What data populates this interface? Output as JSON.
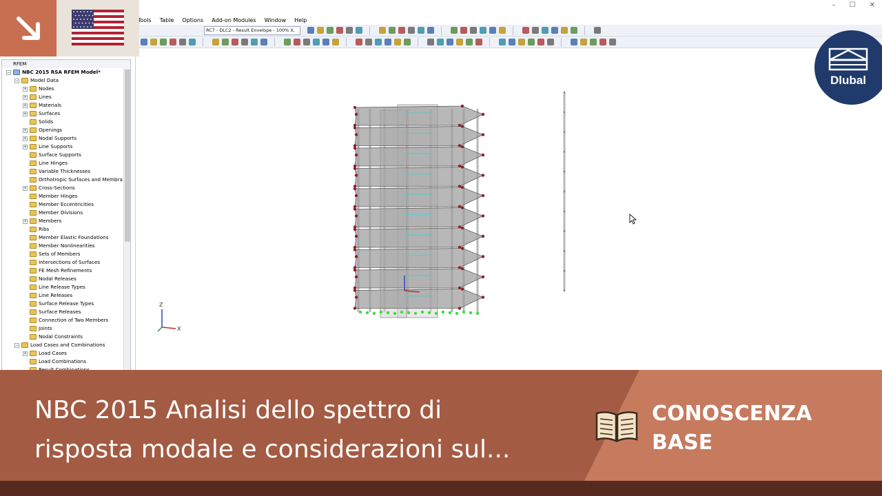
{
  "menu": [
    "Tools",
    "Table",
    "Options",
    "Add-on Modules",
    "Window",
    "Help"
  ],
  "toolbar": {
    "result_combo": "RC7 - DLC2 - Result Envelope - 100% X,"
  },
  "navigator": {
    "root": "RFEM",
    "model": "NBC 2015 RSA RFEM Model*",
    "items": [
      {
        "label": "Model Data",
        "level": 1,
        "expand": "-"
      },
      {
        "label": "Nodes",
        "level": 2,
        "expand": "+"
      },
      {
        "label": "Lines",
        "level": 2,
        "expand": "+"
      },
      {
        "label": "Materials",
        "level": 2,
        "expand": "+"
      },
      {
        "label": "Surfaces",
        "level": 2,
        "expand": "+"
      },
      {
        "label": "Solids",
        "level": 2,
        "expand": ""
      },
      {
        "label": "Openings",
        "level": 2,
        "expand": "+"
      },
      {
        "label": "Nodal Supports",
        "level": 2,
        "expand": "+"
      },
      {
        "label": "Line Supports",
        "level": 2,
        "expand": "+"
      },
      {
        "label": "Surface Supports",
        "level": 2,
        "expand": ""
      },
      {
        "label": "Line Hinges",
        "level": 2,
        "expand": ""
      },
      {
        "label": "Variable Thicknesses",
        "level": 2,
        "expand": ""
      },
      {
        "label": "Orthotropic Surfaces and Membra",
        "level": 2,
        "expand": ""
      },
      {
        "label": "Cross-Sections",
        "level": 2,
        "expand": "+"
      },
      {
        "label": "Member Hinges",
        "level": 2,
        "expand": ""
      },
      {
        "label": "Member Eccentricities",
        "level": 2,
        "expand": ""
      },
      {
        "label": "Member Divisions",
        "level": 2,
        "expand": ""
      },
      {
        "label": "Members",
        "level": 2,
        "expand": "+"
      },
      {
        "label": "Ribs",
        "level": 2,
        "expand": ""
      },
      {
        "label": "Member Elastic Foundations",
        "level": 2,
        "expand": ""
      },
      {
        "label": "Member Nonlinearities",
        "level": 2,
        "expand": ""
      },
      {
        "label": "Sets of Members",
        "level": 2,
        "expand": ""
      },
      {
        "label": "Intersections of Surfaces",
        "level": 2,
        "expand": ""
      },
      {
        "label": "FE Mesh Refinements",
        "level": 2,
        "expand": ""
      },
      {
        "label": "Nodal Releases",
        "level": 2,
        "expand": ""
      },
      {
        "label": "Line Release Types",
        "level": 2,
        "expand": ""
      },
      {
        "label": "Line Releases",
        "level": 2,
        "expand": ""
      },
      {
        "label": "Surface Release Types",
        "level": 2,
        "expand": ""
      },
      {
        "label": "Surface Releases",
        "level": 2,
        "expand": ""
      },
      {
        "label": "Connection of Two Members",
        "level": 2,
        "expand": ""
      },
      {
        "label": "Joints",
        "level": 2,
        "expand": ""
      },
      {
        "label": "Nodal Constraints",
        "level": 2,
        "expand": ""
      },
      {
        "label": "Load Cases and Combinations",
        "level": 1,
        "expand": "-"
      },
      {
        "label": "Load Cases",
        "level": 2,
        "expand": "+"
      },
      {
        "label": "Load Combinations",
        "level": 2,
        "expand": ""
      },
      {
        "label": "Result Combinations",
        "level": 2,
        "expand": ""
      }
    ]
  },
  "viewport": {
    "axis_z": "Z",
    "axis_x": "X"
  },
  "brand": {
    "name": "Dlubal",
    "accent": "#c86f52",
    "navy": "#1f3a6b"
  },
  "banner": {
    "title_line1": "NBC 2015 Analisi dello spettro di",
    "title_line2": "risposta modale e considerazioni sul...",
    "category_line1": "CONOSCENZA",
    "category_line2": "BASE"
  }
}
